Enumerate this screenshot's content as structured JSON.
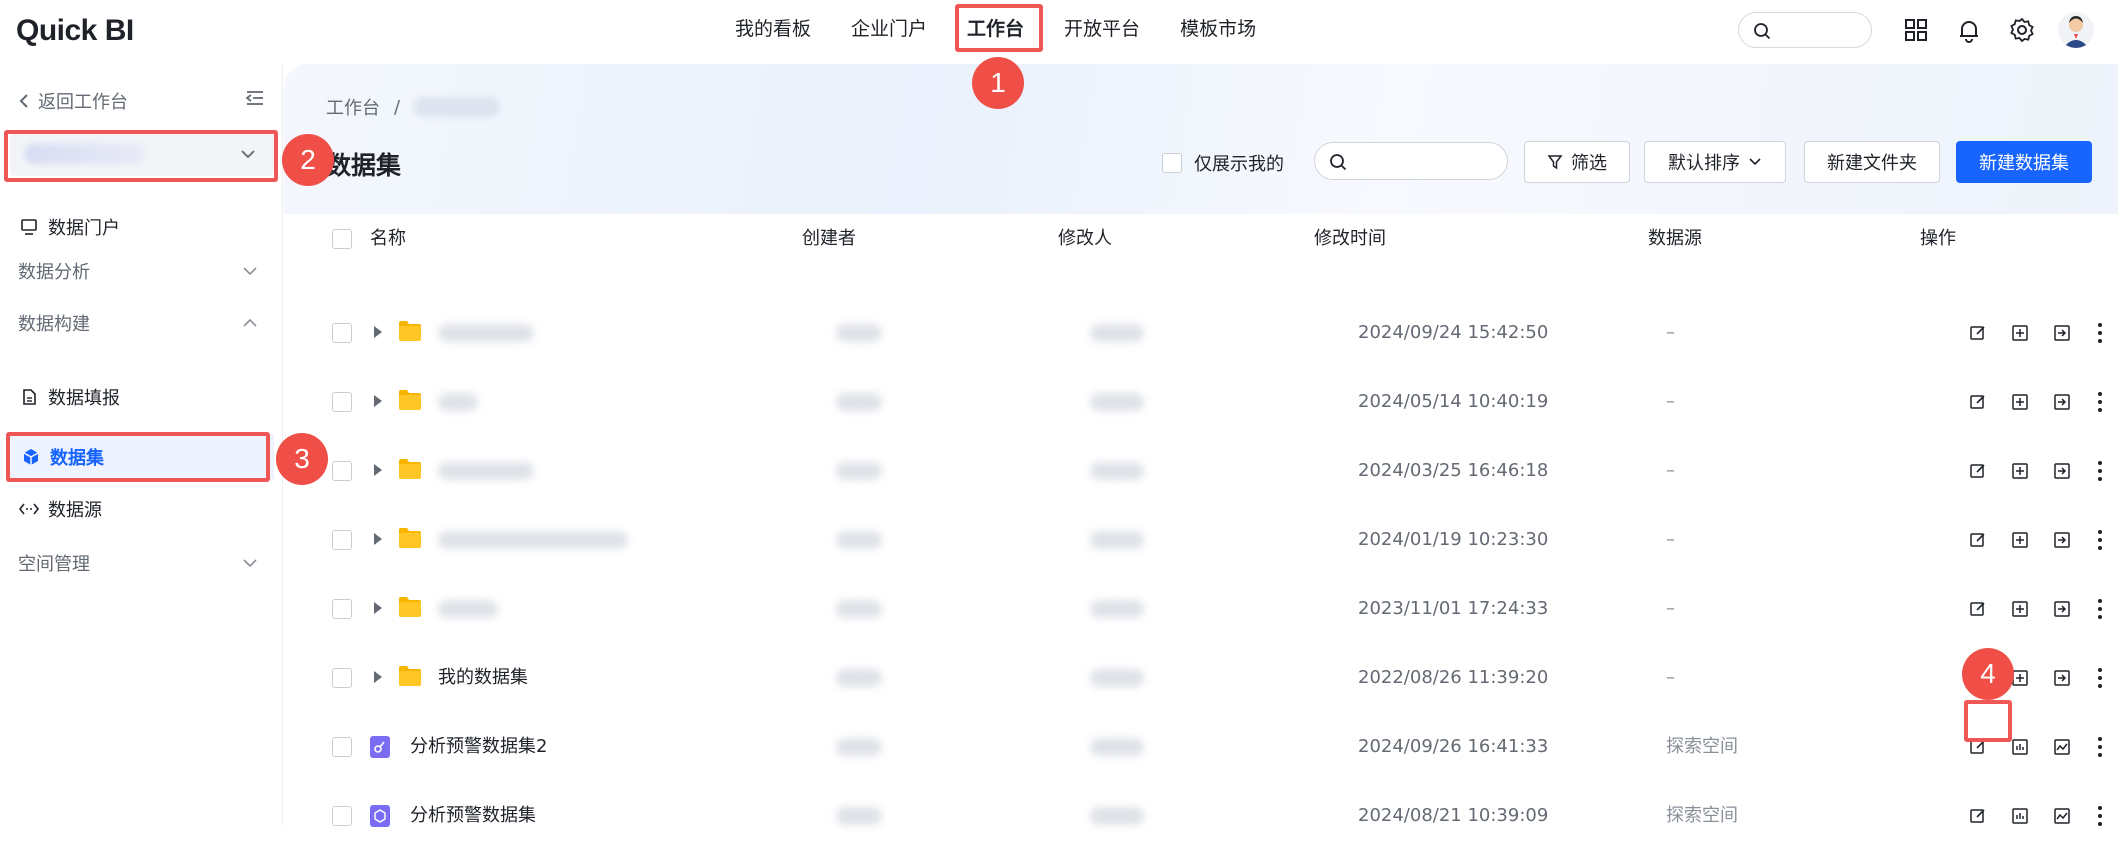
{
  "brand": {
    "logo": "Quick BI"
  },
  "nav": [
    "我的看板",
    "企业门户",
    "工作台",
    "开放平台",
    "模板市场"
  ],
  "nav_active": "工作台",
  "sidebar": {
    "back_label": "返回工作台",
    "items": [
      {
        "label": "数据门户",
        "type": "item"
      },
      {
        "label": "数据分析",
        "type": "group"
      },
      {
        "label": "数据构建",
        "type": "group-open"
      },
      {
        "label": "数据填报",
        "type": "item"
      },
      {
        "label": "数据集",
        "type": "item-active"
      },
      {
        "label": "数据源",
        "type": "item"
      },
      {
        "label": "空间管理",
        "type": "group"
      }
    ]
  },
  "breadcrumb": {
    "root": "工作台",
    "sep": "/"
  },
  "page_title": "数据集",
  "toolbar": {
    "only_mine": "仅展示我的",
    "filter": "筛选",
    "sort": "默认排序",
    "new_folder": "新建文件夹",
    "new_dataset": "新建数据集"
  },
  "table": {
    "headers": [
      "名称",
      "创建者",
      "修改人",
      "修改时间",
      "数据源",
      "操作"
    ],
    "rows": [
      {
        "kind": "folder",
        "name": "",
        "time": "2024/09/24 15:42:50",
        "source": "–"
      },
      {
        "kind": "folder",
        "name": "",
        "time": "2024/05/14 10:40:19",
        "source": "–"
      },
      {
        "kind": "folder",
        "name": "",
        "time": "2024/03/25 16:46:18",
        "source": "–"
      },
      {
        "kind": "folder",
        "name": "",
        "time": "2024/01/19 10:23:30",
        "source": "–"
      },
      {
        "kind": "folder",
        "name": "",
        "time": "2023/11/01 17:24:33",
        "source": "–"
      },
      {
        "kind": "folder",
        "name": "我的数据集",
        "time": "2022/08/26 11:39:20",
        "source": "–"
      },
      {
        "kind": "dataset",
        "name": "分析预警数据集2",
        "time": "2024/09/26 16:41:33",
        "source": "探索空间"
      },
      {
        "kind": "dataset",
        "name": "分析预警数据集",
        "time": "2024/08/21 10:39:09",
        "source": "探索空间"
      }
    ]
  },
  "annotations": [
    "1",
    "2",
    "3",
    "4"
  ],
  "colors": {
    "accent": "#1764ff",
    "highlight": "#ef5656",
    "folder": "#f7b500",
    "dataset": "#7a6cf3"
  }
}
